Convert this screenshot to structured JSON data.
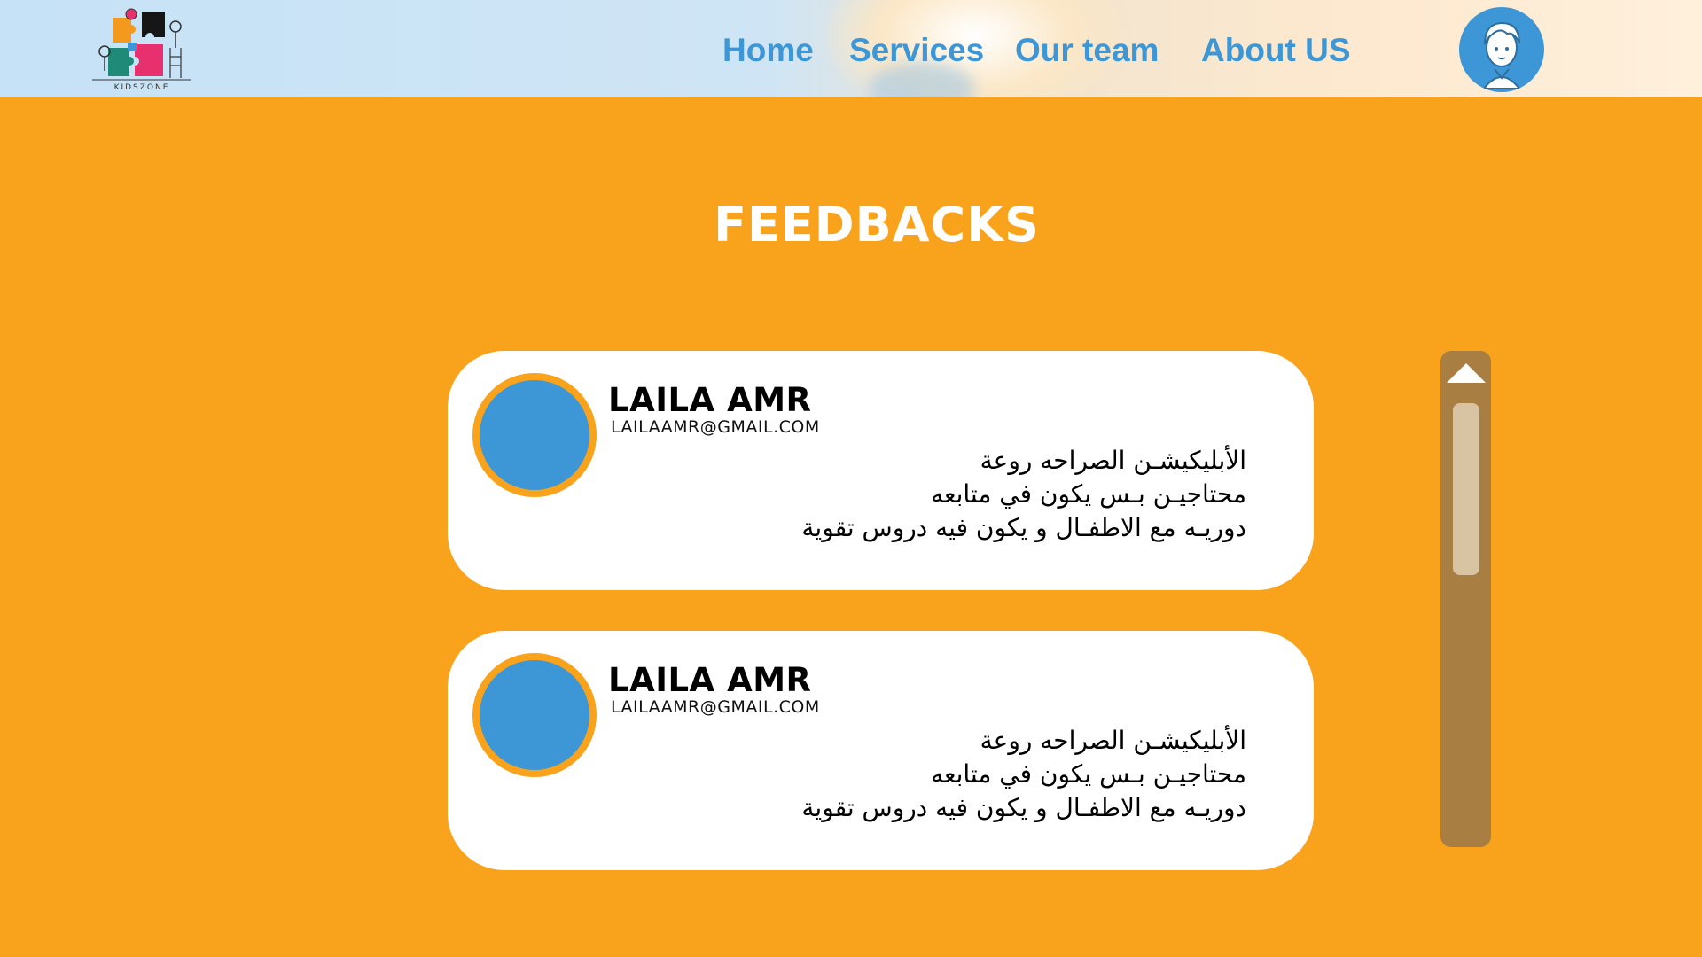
{
  "header": {
    "logo": {
      "caption": "KIDSZONE",
      "icon": "puzzle-kids-logo"
    },
    "nav": [
      {
        "label": "Home"
      },
      {
        "label": "Services"
      },
      {
        "label": "Our team"
      },
      {
        "label": "About US"
      }
    ],
    "profile": {
      "icon": "user-avatar-icon"
    }
  },
  "main": {
    "title": "FEEDBACKS",
    "feedbacks": [
      {
        "name": "LAILA AMR",
        "email": "LAILAAMR@GMAIL.COM",
        "lines": [
          "الأبليكيشـن الصراحه روعة",
          "محتاجيـن بـس يكون في متابعه",
          "دوريـه مع الاطفـال و يكون فيه دروس تقوية"
        ]
      },
      {
        "name": "LAILA AMR",
        "email": "LAILAAMR@GMAIL.COM",
        "lines": [
          "الأبليكيشـن الصراحه روعة",
          "محتاجيـن بـس يكون في متابعه",
          "دوريـه مع الاطفـال و يكون فيه دروس تقوية"
        ]
      }
    ]
  },
  "scrollbar": {
    "up_icon": "triangle-up-icon"
  },
  "colors": {
    "background": "#f9a31c",
    "accent_blue": "#3d97d6",
    "scroll_track": "#a87e43",
    "scroll_thumb": "#d8c4a3",
    "card": "#ffffff"
  }
}
